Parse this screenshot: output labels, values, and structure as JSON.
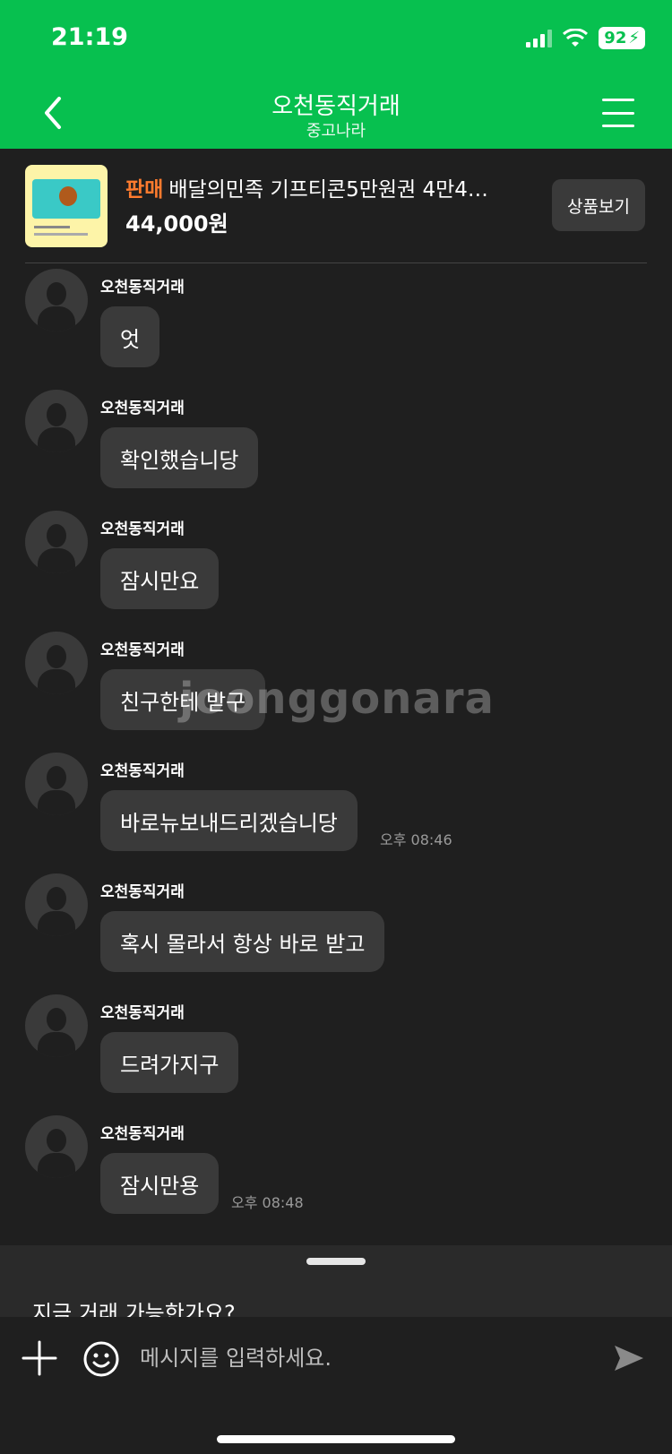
{
  "status_bar": {
    "time": "21:19",
    "battery": "92"
  },
  "nav": {
    "title": "오천동직거래",
    "subtitle": "중고나라"
  },
  "product": {
    "tag": "판매",
    "title": "배달의민족 기프티콘5만원권 4만4…",
    "price": "44,000원",
    "view_button": "상품보기"
  },
  "messages": [
    {
      "sender": "오천동직거래",
      "text": "엇",
      "time": ""
    },
    {
      "sender": "오천동직거래",
      "text": "확인했습니당",
      "time": ""
    },
    {
      "sender": "오천동직거래",
      "text": "잠시만요",
      "time": ""
    },
    {
      "sender": "오천동직거래",
      "text": "친구한테 받구",
      "time": ""
    },
    {
      "sender": "오천동직거래",
      "text": "바로뉴보내드리겠습니당",
      "time": "오후 08:46"
    },
    {
      "sender": "오천동직거래",
      "text": "혹시 몰라서 항상 바로 받고",
      "time": ""
    },
    {
      "sender": "오천동직거래",
      "text": "드려가지구",
      "time": ""
    },
    {
      "sender": "오천동직거래",
      "text": "잠시만용",
      "time": "오후 08:48"
    }
  ],
  "watermark": "joonggonara",
  "quick_reply": {
    "text": "지금 거래 가능한가요?"
  },
  "input": {
    "placeholder": "메시지를 입력하세요."
  }
}
